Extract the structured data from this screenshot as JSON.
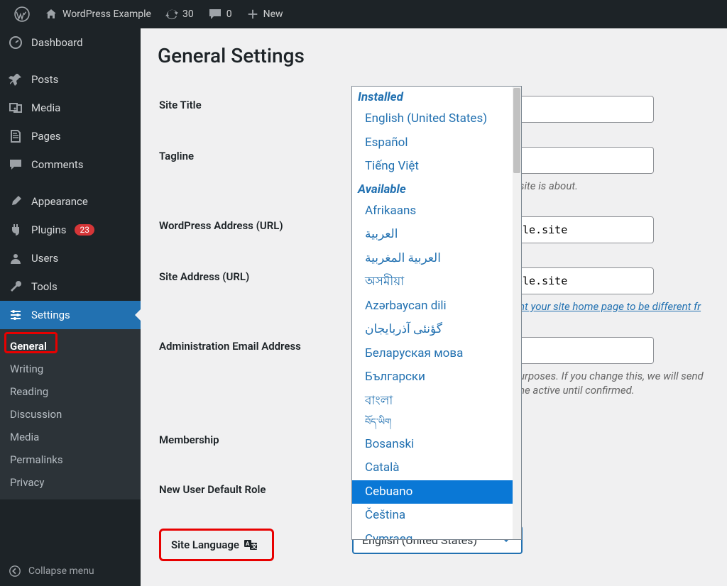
{
  "adminbar": {
    "site_name": "WordPress Example",
    "updates_count": "30",
    "comments_count": "0",
    "new_label": "New"
  },
  "sidebar": {
    "items": [
      {
        "label": "Dashboard"
      },
      {
        "label": "Posts"
      },
      {
        "label": "Media"
      },
      {
        "label": "Pages"
      },
      {
        "label": "Comments"
      },
      {
        "label": "Appearance"
      },
      {
        "label": "Plugins",
        "badge": "23"
      },
      {
        "label": "Users"
      },
      {
        "label": "Tools"
      },
      {
        "label": "Settings"
      }
    ],
    "submenu": [
      {
        "label": "General"
      },
      {
        "label": "Writing"
      },
      {
        "label": "Reading"
      },
      {
        "label": "Discussion"
      },
      {
        "label": "Media"
      },
      {
        "label": "Permalinks"
      },
      {
        "label": "Privacy"
      }
    ],
    "collapse_label": "Collapse menu"
  },
  "page": {
    "title": "General Settings",
    "rows": {
      "site_title": {
        "label": "Site Title"
      },
      "tagline": {
        "label": "Tagline",
        "desc_suffix": " site is about."
      },
      "wp_url": {
        "label": "WordPress Address (URL)",
        "value_suffix": "ple.site"
      },
      "site_url": {
        "label": "Site Address (URL)",
        "value_suffix": "ple.site",
        "desc_link_suffix": "nt your site home page to be different fr"
      },
      "admin_email": {
        "label": "Administration Email Address",
        "desc_line1_suffix": "urposes. If you change this, we will send",
        "desc_line2_suffix": "ne active until confirmed."
      },
      "membership": {
        "label": "Membership"
      },
      "default_role": {
        "label": "New User Default Role"
      },
      "site_language": {
        "label": "Site Language",
        "select_value": "English (United States)"
      }
    }
  },
  "dropdown": {
    "group_installed_label": "Installed",
    "installed": [
      "English (United States)",
      "Español",
      "Tiếng Việt"
    ],
    "group_available_label": "Available",
    "available": [
      "Afrikaans",
      "العربية",
      "العربية المغربية",
      "অসমীয়া",
      "Azərbaycan dili",
      "گؤنئی آذربایجان",
      "Беларуская мова",
      "Български",
      "বাংলা",
      "བོད་ཡིག",
      "Bosanski",
      "Català",
      "Cebuano",
      "Čeština",
      "Cymraeg"
    ],
    "selected": "Cebuano"
  }
}
